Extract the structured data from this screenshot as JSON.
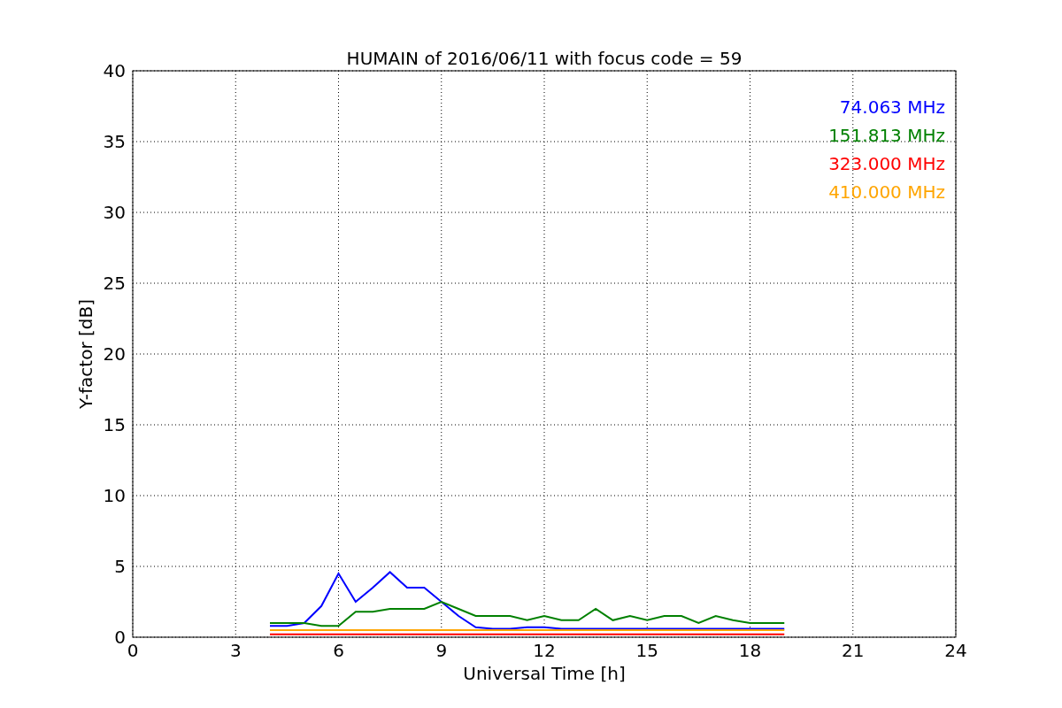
{
  "chart_data": {
    "type": "line",
    "title": "HUMAIN of 2016/06/11 with focus code = 59",
    "xlabel": "Universal Time [h]",
    "ylabel": "Y-factor [dB]",
    "x": [
      4,
      4.5,
      5,
      5.5,
      6,
      6.5,
      7,
      7.5,
      8,
      8.5,
      9,
      9.5,
      10,
      10.5,
      11,
      11.5,
      12,
      12.5,
      13,
      13.5,
      14,
      14.5,
      15,
      15.5,
      16,
      16.5,
      17,
      17.5,
      18,
      18.5,
      19
    ],
    "series": [
      {
        "name": "74.063 MHz",
        "color": "#0000ff",
        "values": [
          0.8,
          0.8,
          1,
          2.2,
          4.5,
          2.5,
          3.5,
          4.6,
          3.5,
          3.5,
          2.5,
          1.5,
          0.7,
          0.6,
          0.6,
          0.7,
          0.7,
          0.6,
          0.6,
          0.6,
          0.6,
          0.6,
          0.6,
          0.6,
          0.6,
          0.6,
          0.6,
          0.6,
          0.6,
          0.6,
          0.6
        ]
      },
      {
        "name": "151.813 MHz",
        "color": "#008000",
        "values": [
          1,
          1,
          1,
          0.8,
          0.8,
          1.8,
          1.8,
          2,
          2,
          2,
          2.5,
          2,
          1.5,
          1.5,
          1.5,
          1.2,
          1.5,
          1.2,
          1.2,
          2,
          1.2,
          1.5,
          1.2,
          1.5,
          1.5,
          1,
          1.5,
          1.2,
          1,
          1,
          1
        ]
      },
      {
        "name": "323.000 MHz",
        "color": "#ff0000",
        "values": [
          0.2,
          0.2,
          0.2,
          0.2,
          0.2,
          0.2,
          0.2,
          0.2,
          0.2,
          0.2,
          0.2,
          0.2,
          0.2,
          0.2,
          0.2,
          0.2,
          0.2,
          0.2,
          0.2,
          0.2,
          0.2,
          0.2,
          0.2,
          0.2,
          0.2,
          0.2,
          0.2,
          0.2,
          0.2,
          0.2,
          0.2
        ]
      },
      {
        "name": "410.000 MHz",
        "color": "#ffa500",
        "values": [
          0.5,
          0.5,
          0.5,
          0.5,
          0.5,
          0.5,
          0.5,
          0.5,
          0.5,
          0.5,
          0.5,
          0.5,
          0.5,
          0.5,
          0.5,
          0.5,
          0.5,
          0.5,
          0.5,
          0.5,
          0.5,
          0.5,
          0.5,
          0.5,
          0.5,
          0.5,
          0.5,
          0.5,
          0.5,
          0.5,
          0.5
        ]
      }
    ],
    "xlim": [
      0,
      24
    ],
    "ylim": [
      0,
      40
    ],
    "xticks": [
      0,
      3,
      6,
      9,
      12,
      15,
      18,
      21,
      24
    ],
    "yticks": [
      0,
      5,
      10,
      15,
      20,
      25,
      30,
      35,
      40
    ],
    "grid": true
  }
}
